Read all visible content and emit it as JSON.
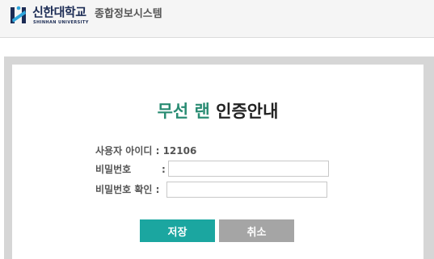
{
  "header": {
    "logo_korean": "신한대학교",
    "logo_english": "SHINHAN UNIVERSITY",
    "system_name": "종합정보시스템",
    "logo_color": "#1c2c55"
  },
  "dialog": {
    "title_accent": "무선 랜",
    "title_rest": "인증안내",
    "accent_color": "#2a8c73",
    "user_id_label": "사용자 아이디",
    "user_id_value": ": 12106",
    "password_label": "비밀번호",
    "password_confirm_label": "비밀번호 확인",
    "colon": ":",
    "password_value": "",
    "password_confirm_value": ""
  },
  "buttons": {
    "save": "저장",
    "cancel": "취소",
    "save_color": "#1ba6a0",
    "cancel_color": "#a5a5a5"
  }
}
